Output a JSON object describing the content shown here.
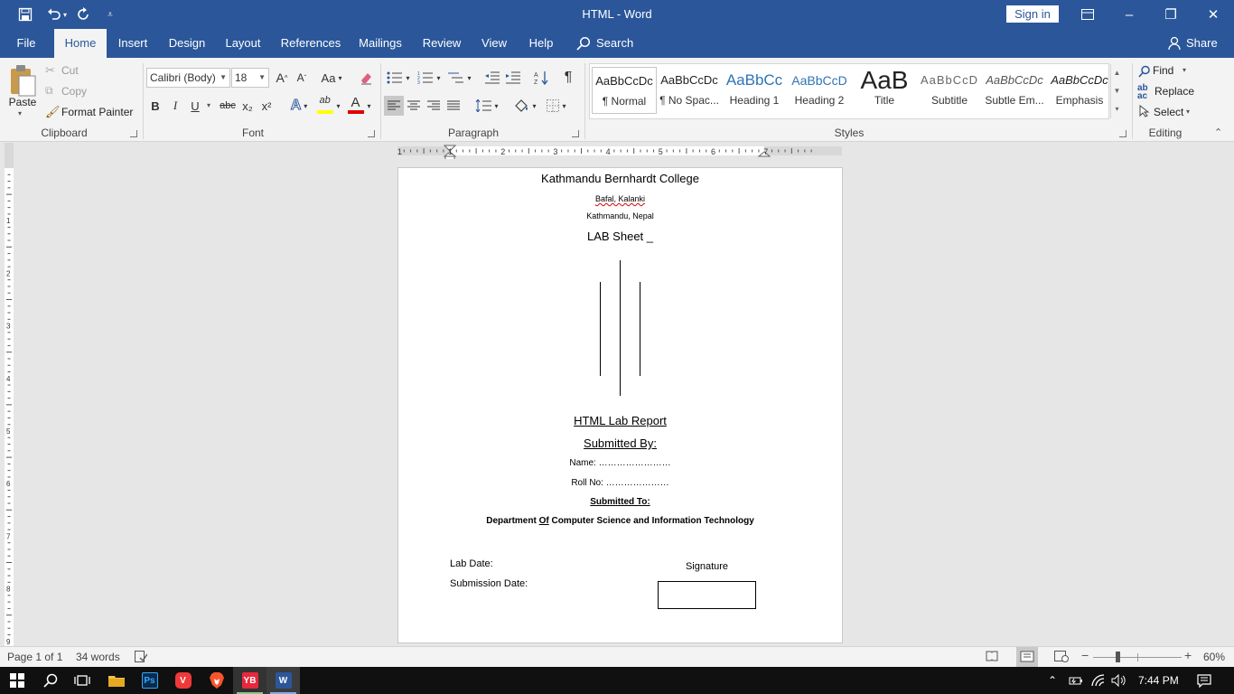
{
  "window": {
    "title": "HTML  -  Word",
    "sign_in": "Sign in",
    "minimize_icon": "–",
    "maximize_icon": "❐",
    "close_icon": "✕"
  },
  "tabs": [
    "File",
    "Home",
    "Insert",
    "Design",
    "Layout",
    "References",
    "Mailings",
    "Review",
    "View",
    "Help"
  ],
  "search_label": "Search",
  "share_label": "Share",
  "ribbon": {
    "clipboard": {
      "paste": "Paste",
      "cut": "Cut",
      "copy": "Copy",
      "format_painter": "Format Painter",
      "label": "Clipboard"
    },
    "font": {
      "family": "Calibri (Body)",
      "size": "18",
      "label": "Font",
      "bold": "B",
      "italic": "I",
      "underline": "U",
      "strike": "abc",
      "subscript": "x₂",
      "superscript": "x²",
      "grow": "A",
      "shrink": "A",
      "case": "Aa"
    },
    "paragraph": {
      "label": "Paragraph",
      "pilcrow": "¶"
    },
    "styles": {
      "label": "Styles",
      "items": [
        {
          "preview": "AaBbCcDc",
          "name": "¶ Normal"
        },
        {
          "preview": "AaBbCcDc",
          "name": "¶ No Spac..."
        },
        {
          "preview": "AaBbCc",
          "name": "Heading 1"
        },
        {
          "preview": "AaBbCcD",
          "name": "Heading 2"
        },
        {
          "preview": "AaB",
          "name": "Title"
        },
        {
          "preview": "AaBbCcD",
          "name": "Subtitle"
        },
        {
          "preview": "AaBbCcDc",
          "name": "Subtle Em..."
        },
        {
          "preview": "AaBbCcDc",
          "name": "Emphasis"
        }
      ]
    },
    "editing": {
      "label": "Editing",
      "find": "Find",
      "replace": "Replace",
      "select": "Select"
    }
  },
  "ruler": {
    "h_ticks": [
      "1",
      "1",
      "2",
      "3",
      "4",
      "5",
      "6",
      "7"
    ],
    "v_ticks": [
      "1",
      "2",
      "3",
      "4",
      "5",
      "6",
      "7",
      "8",
      "9"
    ]
  },
  "document": {
    "college": "Kathmandu Bernhardt College",
    "address1": "Bafal, Kalanki",
    "address2": "Kathmandu, Nepal",
    "lab_sheet": "LAB Sheet _",
    "report_title": "HTML Lab Report",
    "submitted_by": "Submitted By:",
    "name_line": "Name: ……………………",
    "roll_line": "Roll No: …………………",
    "submitted_to": "Submitted To:",
    "department_pre": "Department ",
    "department_of": "Of",
    "department_post": " Computer Science and Information Technology",
    "lab_date": "Lab Date:",
    "submission_date": "Submission Date:",
    "signature": "Signature"
  },
  "status": {
    "page": "Page 1 of 1",
    "words": "34 words",
    "zoom": "60%"
  },
  "taskbar": {
    "time": "7:44 PM"
  },
  "colors": {
    "brand": "#2b579a",
    "font_color_bar": "#e00000",
    "highlight_bar": "#ffff00"
  }
}
